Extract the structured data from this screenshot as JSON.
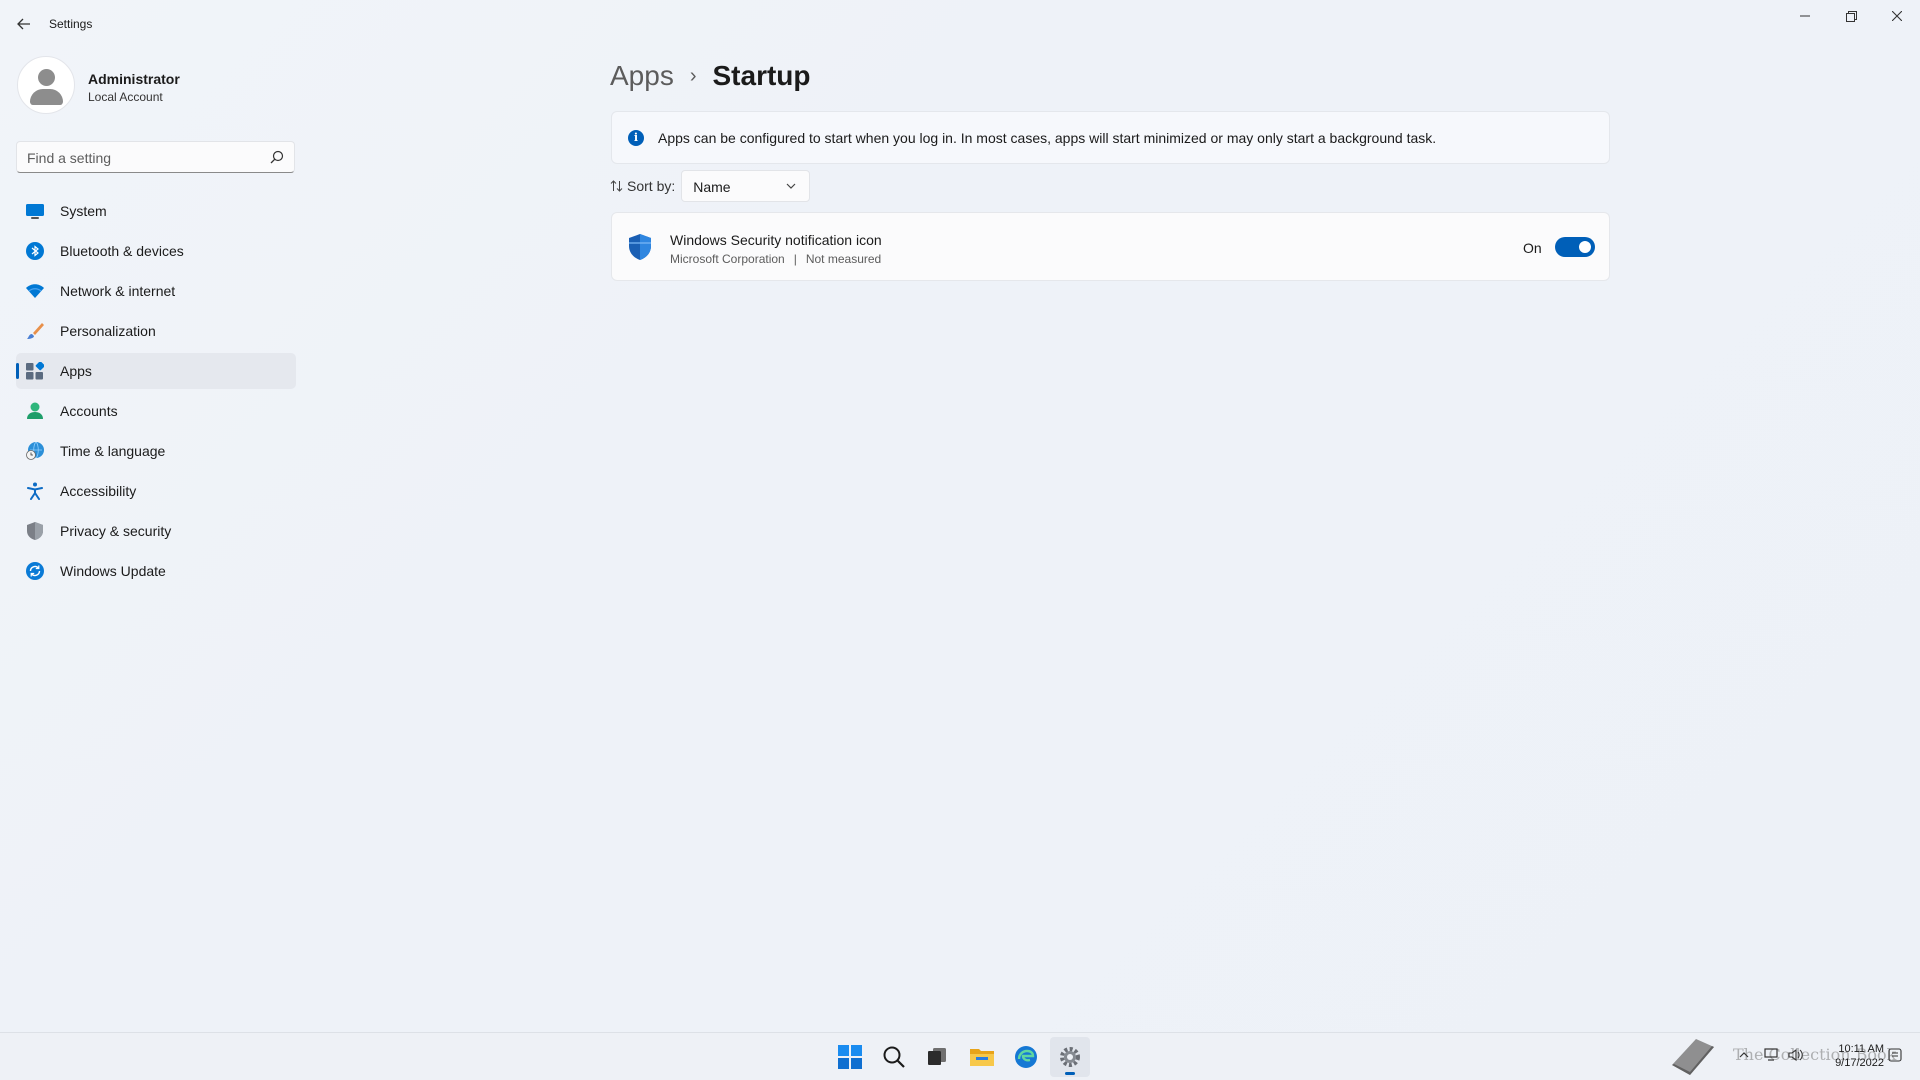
{
  "window": {
    "title": "Settings",
    "controls": {
      "minimize": "—",
      "restore": "❐",
      "close": "✕"
    }
  },
  "profile": {
    "name": "Administrator",
    "account_type": "Local Account"
  },
  "search": {
    "placeholder": "Find a setting",
    "value": ""
  },
  "sidebar": {
    "items": [
      {
        "label": "System",
        "icon": "system-icon"
      },
      {
        "label": "Bluetooth & devices",
        "icon": "bluetooth-icon"
      },
      {
        "label": "Network & internet",
        "icon": "wifi-icon"
      },
      {
        "label": "Personalization",
        "icon": "brush-icon"
      },
      {
        "label": "Apps",
        "icon": "apps-icon",
        "active": true
      },
      {
        "label": "Accounts",
        "icon": "accounts-icon"
      },
      {
        "label": "Time & language",
        "icon": "globe-clock-icon"
      },
      {
        "label": "Accessibility",
        "icon": "accessibility-icon"
      },
      {
        "label": "Privacy & security",
        "icon": "shield-icon"
      },
      {
        "label": "Windows Update",
        "icon": "update-icon"
      }
    ]
  },
  "main": {
    "breadcrumb": {
      "parent": "Apps",
      "separator": "›",
      "current": "Startup"
    },
    "info": {
      "icon": "info-icon",
      "text": "Apps can be configured to start when you log in. In most cases, apps will start minimized or may only start a background task."
    },
    "sort": {
      "label": "Sort by:",
      "value": "Name",
      "icon": "sort-icon"
    },
    "startup_apps": [
      {
        "name": "Windows Security notification icon",
        "publisher": "Microsoft Corporation",
        "impact": "Not measured",
        "state_label": "On",
        "enabled": true,
        "icon": "windows-security-shield-icon"
      }
    ]
  },
  "taskbar": {
    "icons": [
      "start-icon",
      "search-icon",
      "task-view-icon",
      "file-explorer-icon",
      "edge-icon",
      "settings-icon"
    ],
    "active": "settings-icon",
    "clock": {
      "time": "10:11 AM",
      "date": "9/17/2022"
    },
    "watermark": "The Collection Book"
  },
  "colors": {
    "accent": "#005fb8",
    "background": "#eef2f8",
    "card": "#fbfbfc"
  }
}
